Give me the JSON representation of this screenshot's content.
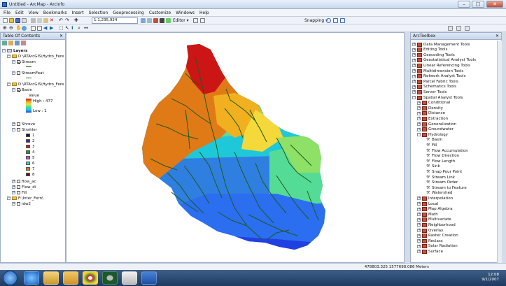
{
  "window": {
    "title": "Untitled - ArcMap - ArcInfo"
  },
  "menubar": {
    "items": [
      "File",
      "Edit",
      "View",
      "Bookmarks",
      "Insert",
      "Selection",
      "Geoprocessing",
      "Customize",
      "Windows",
      "Help"
    ]
  },
  "toolbar": {
    "scale": "1:1,235,924",
    "editor_label": "Editor ▾",
    "snapping_label": "Snapping ▾"
  },
  "toc": {
    "title": "Table Of Contents",
    "layers_label": "Layers",
    "group1": "D:\\RTArcGIS\\Hydro_Fere",
    "stream": "Stream",
    "streamfeat": "StreamFeat",
    "group2": "D:\\RTArcGIS\\Hydro_Fere",
    "basin": "Basin",
    "value_label": "Value",
    "high": "High : 477",
    "low": "Low : 1",
    "shreve": "Shreve",
    "strahler": "Strahler",
    "strahler_classes": [
      {
        "label": "1",
        "color": "#1a1a1a"
      },
      {
        "label": "2",
        "color": "#3a2aa8"
      },
      {
        "label": "3",
        "color": "#c01f1f"
      },
      {
        "label": "4",
        "color": "#2d8a2d"
      },
      {
        "label": "5",
        "color": "#c84bd0"
      },
      {
        "label": "6",
        "color": "#3cc8d8"
      },
      {
        "label": "7",
        "color": "#d07a2a"
      },
      {
        "label": "8",
        "color": "#4a1a1a"
      }
    ],
    "flow_ac": "flow_ac",
    "flow_di": "Flow_di",
    "fill": "Fill",
    "group3": "F:\\Inter_Fern\\",
    "idw2": "idw2"
  },
  "toolbox": {
    "title": "ArcToolbox",
    "top_items": [
      "Data Management Tools",
      "Editing Tools",
      "Geocoding Tools",
      "Geostatistical Analyst Tools",
      "Linear Referencing Tools",
      "Multidimension Tools",
      "Network Analyst Tools",
      "Parcel Fabric Tools",
      "Schematics Tools",
      "Server Tools",
      "Spatial Analyst Tools"
    ],
    "spatial_items": [
      "Conditional",
      "Density",
      "Distance",
      "Extraction",
      "Generalization",
      "Groundwater",
      "Hydrology"
    ],
    "hydrology_tools": [
      "Basin",
      "Fill",
      "Flow Accumulation",
      "Flow Direction",
      "Flow Length",
      "Sink",
      "Snap Pour Point",
      "Stream Link",
      "Stream Order",
      "Stream to Feature",
      "Watershed"
    ],
    "after_items": [
      "Interpolation",
      "Local",
      "Map Algebra",
      "Math",
      "Multivariate",
      "Neighborhood",
      "Overlay",
      "Raster Creation",
      "Reclass",
      "Solar Radiation",
      "Surface"
    ]
  },
  "status": {
    "coords": "478803.325  1577698.086 Meters"
  },
  "taskbar": {
    "time": "12:08",
    "date": "9/1/2007"
  }
}
